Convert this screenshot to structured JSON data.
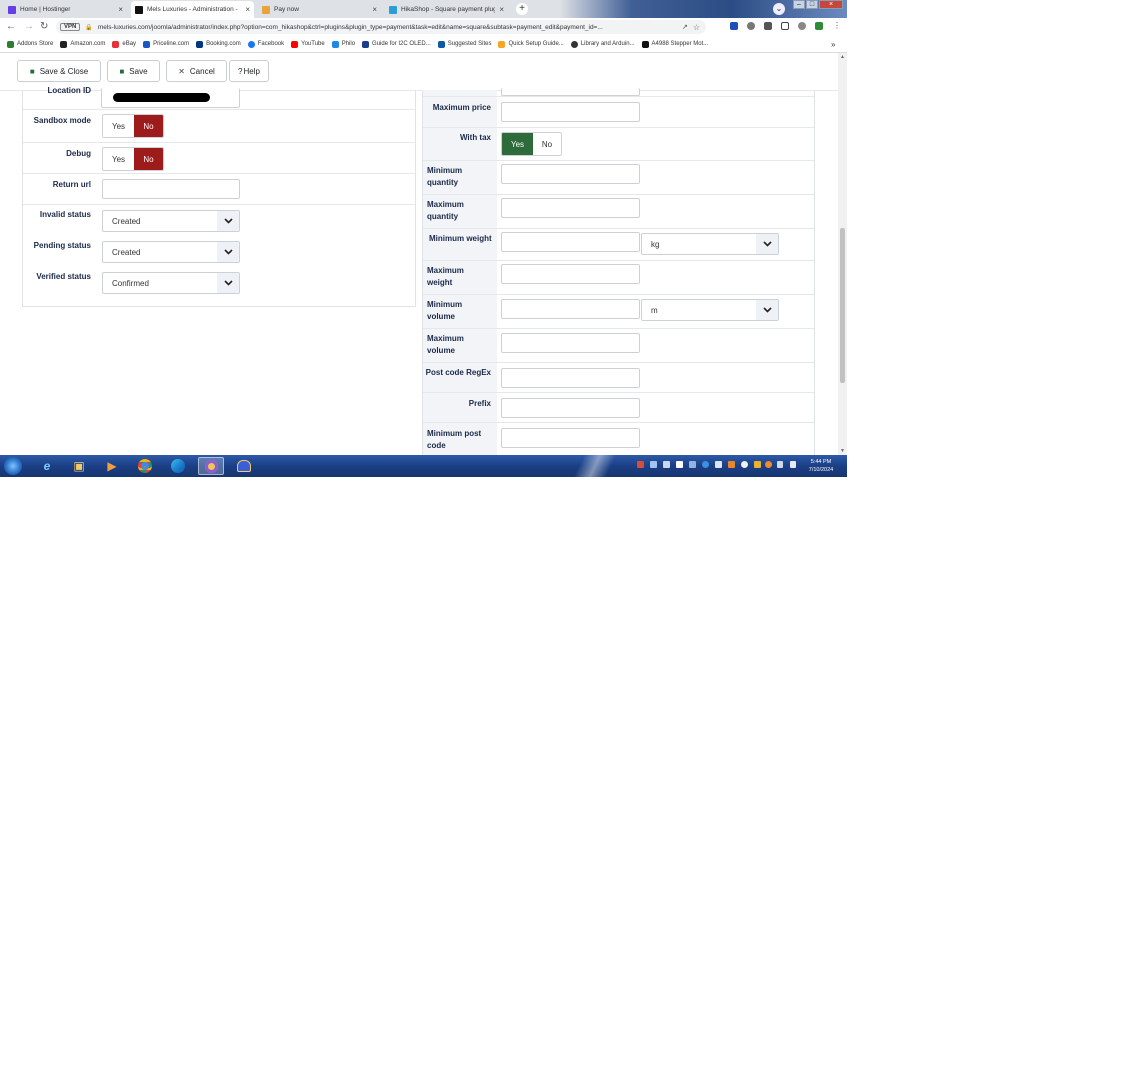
{
  "browser": {
    "tabs": [
      {
        "title": "Home | Hostinger",
        "close": "×",
        "color": "#673de6"
      },
      {
        "title": "Mels Luxuries - Administration -",
        "close": "×",
        "color": "#111111"
      },
      {
        "title": "Pay now",
        "close": "×",
        "color": "#e8a33c"
      },
      {
        "title": "HikaShop - Square payment plug",
        "close": "×",
        "color": "#2a9fd6"
      }
    ],
    "new_tab": "+",
    "vpn": "VPN",
    "url": "mels-luxuries.com/joomla/administrator/index.php?option=com_hikashop&ctrl=plugins&plugin_type=payment&task=edit&name=square&subtask=payment_edit&payment_id=...",
    "bookmarks": [
      {
        "label": "Addons Store",
        "color": "#2e7d32"
      },
      {
        "label": "Amazon.com",
        "color": "#222222"
      },
      {
        "label": "eBay",
        "color": "#e53238"
      },
      {
        "label": "Priceline.com",
        "color": "#1a56c4"
      },
      {
        "label": "Booking.com",
        "color": "#003580"
      },
      {
        "label": "Facebook",
        "color": "#1877f2"
      },
      {
        "label": "YouTube",
        "color": "#ff0000"
      },
      {
        "label": "Philo",
        "color": "#1e88e5"
      },
      {
        "label": "Guide for I2C OLED...",
        "color": "#1a3c8a"
      },
      {
        "label": "Suggested Sites",
        "color": "#0c59a4"
      },
      {
        "label": "Quick Setup Guide...",
        "color": "#f5a623"
      },
      {
        "label": "Library and Arduin...",
        "color": "#333333"
      },
      {
        "label": "A4988 Stepper Mot...",
        "color": "#111111"
      }
    ],
    "more_bookmarks": "»"
  },
  "toolbar": {
    "save_close": "Save & Close",
    "save": "Save",
    "cancel": "Cancel",
    "help": "Help"
  },
  "left": {
    "location_id_label": "Location ID",
    "sandbox_label": "Sandbox mode",
    "sandbox": {
      "yes": "Yes",
      "no": "No",
      "selected": "No"
    },
    "debug_label": "Debug",
    "debug": {
      "yes": "Yes",
      "no": "No",
      "selected": "No"
    },
    "return_url_label": "Return url",
    "return_url_value": "",
    "invalid_status_label": "Invalid status",
    "invalid_status": "Created",
    "pending_status_label": "Pending status",
    "pending_status": "Created",
    "verified_status_label": "Verified status",
    "verified_status": "Confirmed"
  },
  "right": {
    "max_price_label": "Maximum price",
    "with_tax_label": "With tax",
    "with_tax": {
      "yes": "Yes",
      "no": "No",
      "selected": "Yes"
    },
    "min_qty_label": "Minimum quantity",
    "max_qty_label": "Maximum quantity",
    "min_weight_label": "Minimum weight",
    "weight_unit": "kg",
    "max_weight_label": "Maximum weight",
    "min_volume_label": "Minimum volume",
    "volume_unit": "m",
    "max_volume_label": "Maximum volume",
    "post_code_regex_label": "Post code RegEx",
    "prefix_label": "Prefix",
    "min_post_code_label": "Minimum post code"
  },
  "taskbar": {
    "time": "5:44 PM",
    "date": "7/10/2024"
  },
  "colors": {
    "toggle_no_active": "#9e1b1b",
    "toggle_yes_active": "#2e6b3a",
    "label_text": "#1b2a4a"
  }
}
